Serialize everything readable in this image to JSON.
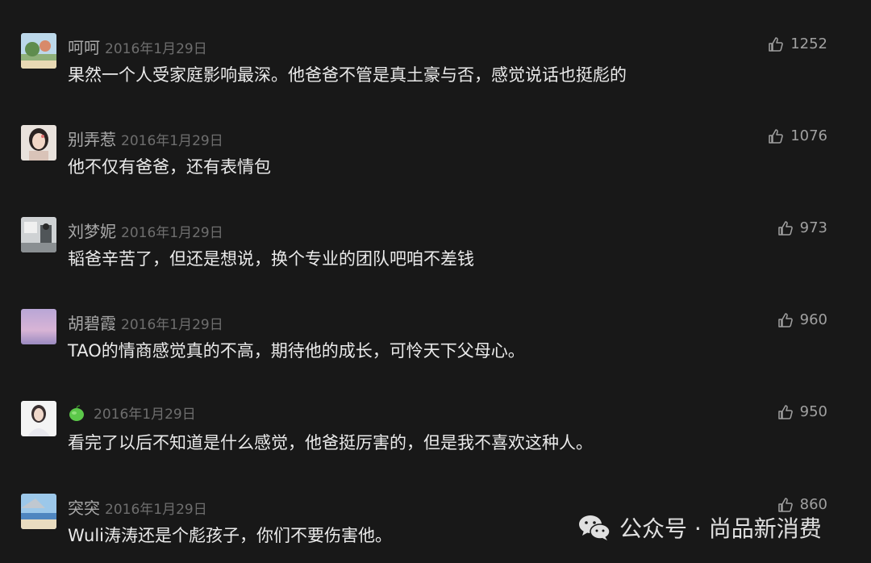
{
  "comments": [
    {
      "username": "呵呵",
      "date": "2016年1月29日",
      "likes": "1252",
      "text": "果然一个人受家庭影响最深。他爸爸不管是真土豪与否，感觉说话也挺彪的",
      "avatar": "landscape-photo-avatar"
    },
    {
      "username": "别弄惹",
      "date": "2016年1月29日",
      "likes": "1076",
      "text": "他不仅有爸爸，还有表情包",
      "avatar": "girl-portrait-avatar"
    },
    {
      "username": "刘梦妮",
      "date": "2016年1月29日",
      "likes": "973",
      "text": "韬爸辛苦了，但还是想说，换个专业的团队吧咱不差钱",
      "avatar": "room-photo-avatar"
    },
    {
      "username": "胡碧霞",
      "date": "2016年1月29日",
      "likes": "960",
      "text": "TAO的情商感觉真的不高，期待他的成长，可怜天下父母心。",
      "avatar": "purple-sky-avatar"
    },
    {
      "username": "",
      "date": "2016年1月29日",
      "likes": "950",
      "text": "看完了以后不知道是什么感觉，他爸挺厉害的，但是我不喜欢这种人。",
      "avatar": "girl-white-avatar",
      "username_icon": "green-apple-icon"
    },
    {
      "username": "突突",
      "date": "2016年1月29日",
      "likes": "860",
      "text": "Wuli涛涛还是个彪孩子，你们不要伤害他。",
      "avatar": "beach-sky-avatar"
    }
  ],
  "watermark": {
    "text": "公众号 · 尚品新消费",
    "icon": "wechat-icon"
  },
  "colors": {
    "background": "#181818",
    "username": "#a8a8a8",
    "date": "#6e6e6e",
    "text": "#eaeaea"
  }
}
